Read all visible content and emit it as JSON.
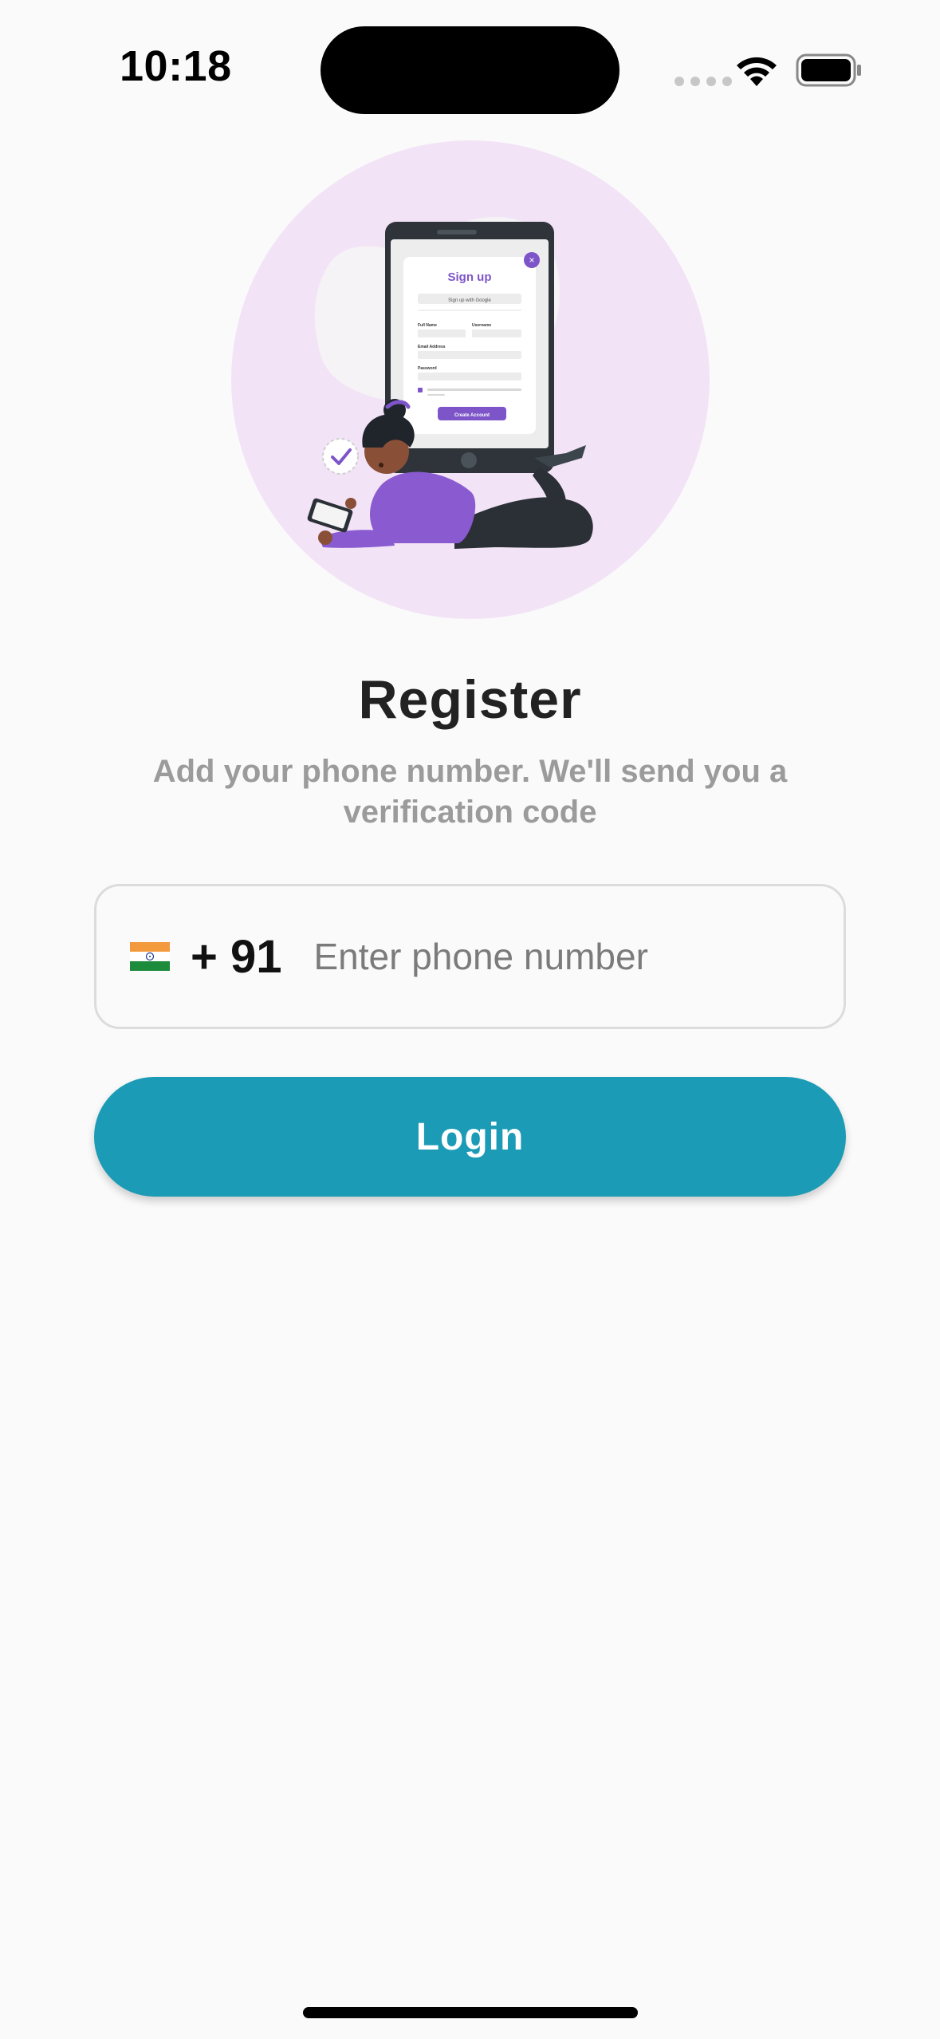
{
  "status_bar": {
    "time": "10:18",
    "icons": [
      "signal-dots-icon",
      "wifi-icon",
      "battery-icon"
    ]
  },
  "illustration": {
    "card_title": "Sign up",
    "google_label": "Sign up with Google",
    "full_name_label": "Full Name",
    "username_label": "Username",
    "email_label": "Email Address",
    "password_label": "Password",
    "create_button": "Create Account"
  },
  "title": "Register",
  "subtitle": "Add your phone number. We'll send you a verification code",
  "phone": {
    "flag": "india-flag-icon",
    "country_code": "+ 91",
    "placeholder": "Enter phone number",
    "value": ""
  },
  "login_label": "Login",
  "colors": {
    "accent": "#1b9bb5",
    "illustration_bg": "#f3e3f6",
    "brand_purple": "#7e55c9"
  }
}
